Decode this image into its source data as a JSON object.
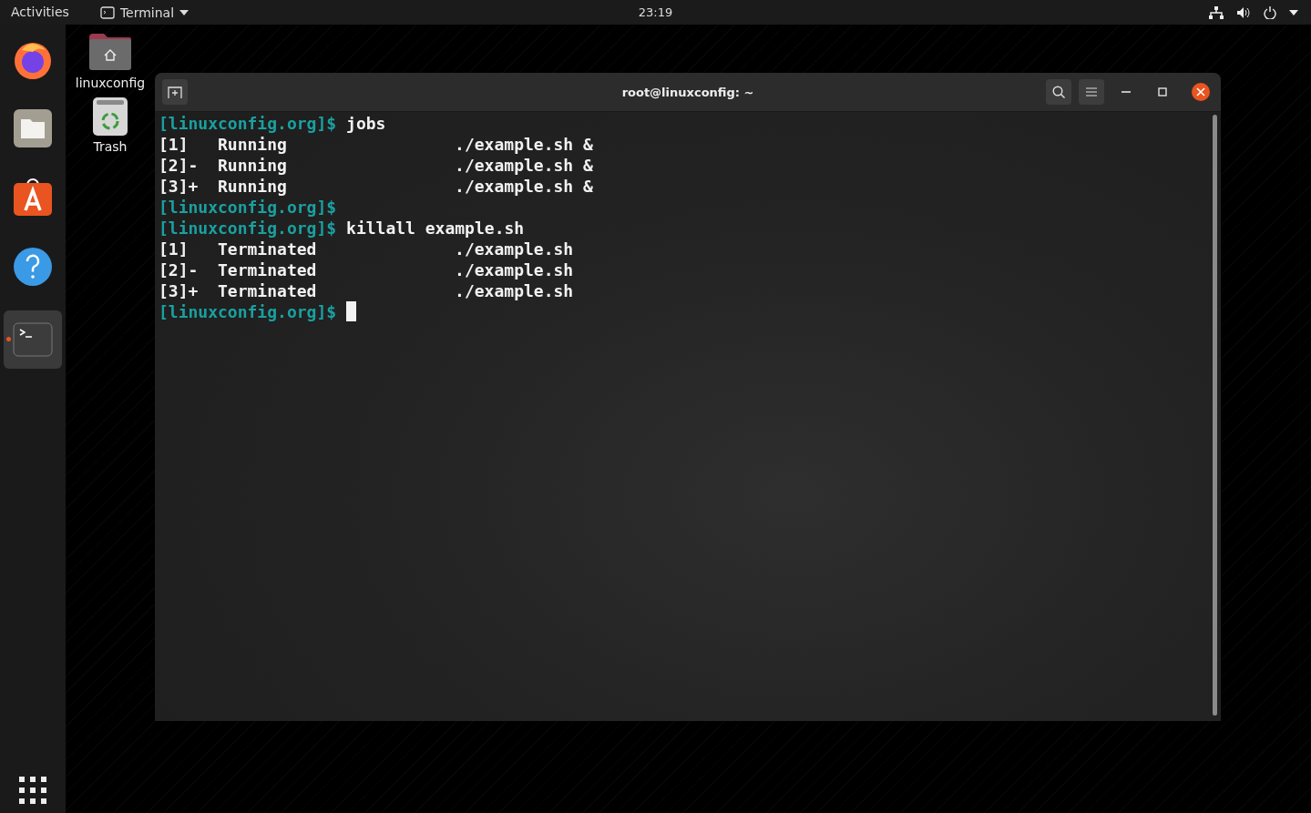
{
  "top_bar": {
    "activities": "Activities",
    "app_menu": "Terminal",
    "clock": "23:19"
  },
  "dock": {
    "items": [
      {
        "kind": "firefox",
        "running": false,
        "selected": false
      },
      {
        "kind": "files",
        "running": false,
        "selected": false
      },
      {
        "kind": "software",
        "running": false,
        "selected": false
      },
      {
        "kind": "help",
        "running": false,
        "selected": false
      },
      {
        "kind": "terminal",
        "running": true,
        "selected": true
      }
    ]
  },
  "desktop_icons": [
    {
      "kind": "home-folder",
      "label": "linuxconfig"
    },
    {
      "kind": "trash",
      "label": "Trash"
    }
  ],
  "terminal": {
    "title": "root@linuxconfig: ~",
    "cursor": true,
    "lines": [
      {
        "prompt": "[linuxconfig.org]$",
        "text": "jobs"
      },
      {
        "text": "[1]   Running                 ./example.sh &"
      },
      {
        "text": "[2]-  Running                 ./example.sh &"
      },
      {
        "text": "[3]+  Running                 ./example.sh &"
      },
      {
        "prompt": "[linuxconfig.org]$"
      },
      {
        "prompt": "[linuxconfig.org]$",
        "text": "killall example.sh"
      },
      {
        "text": "[1]   Terminated              ./example.sh"
      },
      {
        "text": "[2]-  Terminated              ./example.sh"
      },
      {
        "text": "[3]+  Terminated              ./example.sh"
      },
      {
        "prompt": "[linuxconfig.org]$"
      }
    ]
  }
}
